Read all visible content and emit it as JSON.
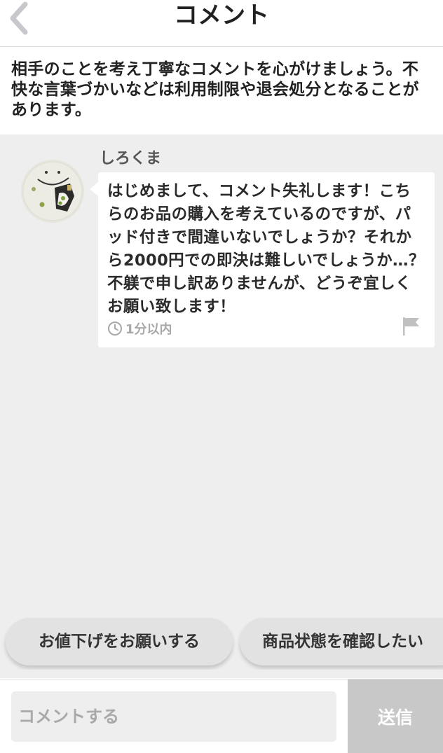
{
  "header": {
    "title": "コメント",
    "back_icon": "chevron-left-icon"
  },
  "notice": {
    "text": "相手のことを考え丁寧なコメントを心がけましょう。不快な言葉づかいなどは利用制限や退会処分となることがあります。"
  },
  "comment": {
    "username": "しろくま",
    "avatar": "avatar-illustration",
    "message": "はじめまして、コメント失礼します！こちらのお品の購入を考えているのですが、パッド付きで間違いないでしょうか？それから2000円での即決は難しいでしょうか…？不躾で申し訳ありませんが、どうぞ宜しくお願い致します！",
    "time": "1分以内",
    "clock_icon": "clock-icon",
    "flag_icon": "flag-icon"
  },
  "quick_replies": [
    {
      "label": "お値下げをお願いする"
    },
    {
      "label": "商品状態を確認したい"
    }
  ],
  "composer": {
    "placeholder": "コメントする",
    "value": "",
    "send_label": "送信"
  },
  "colors": {
    "thread_background": "#eeeeee",
    "send_button": "#c8c8c8",
    "muted_text": "#a8a8a8"
  }
}
